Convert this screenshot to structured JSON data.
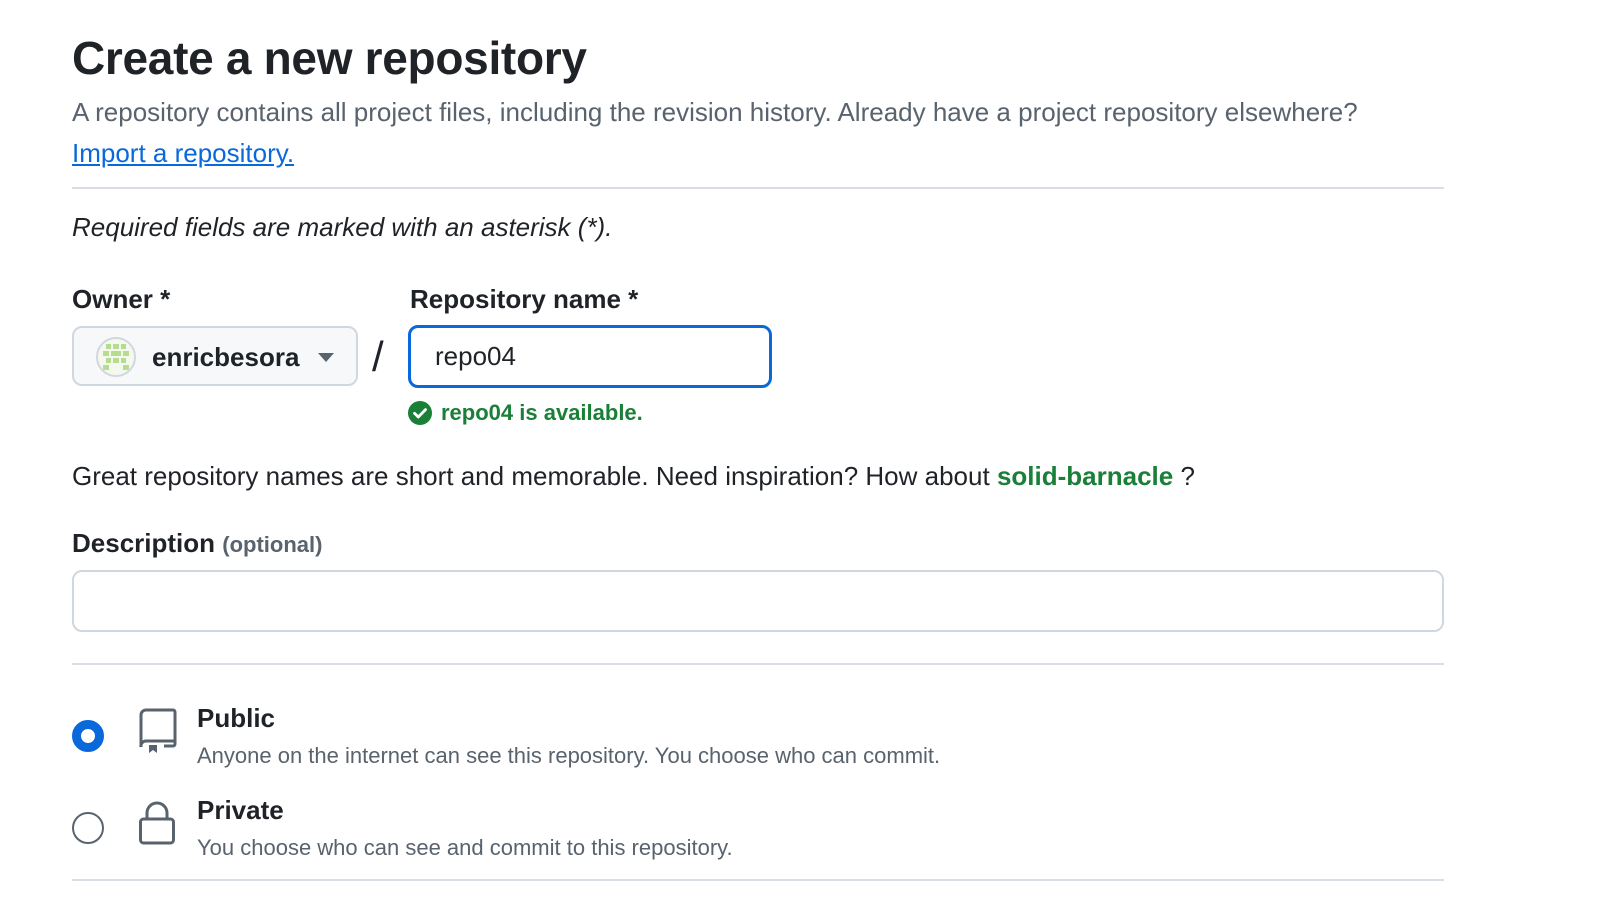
{
  "header": {
    "title": "Create a new repository",
    "subtitle": "A repository contains all project files, including the revision history. Already have a project repository elsewhere?",
    "import_link": "Import a repository."
  },
  "form": {
    "required_note": "Required fields are marked with an asterisk (*).",
    "owner": {
      "label": "Owner *",
      "value": "enricbesora"
    },
    "separator": "/",
    "repo_name": {
      "label": "Repository name *",
      "value": "repo04",
      "availability": "repo04 is available."
    },
    "hint": {
      "text": "Great repository names are short and memorable. Need inspiration? How about",
      "suggestion": "solid-barnacle",
      "suffix": "?"
    },
    "description": {
      "label": "Description",
      "optional": "(optional)",
      "value": ""
    },
    "visibility": {
      "selected": "Public",
      "options": [
        {
          "title": "Public",
          "description": "Anyone on the internet can see this repository. You choose who can commit.",
          "icon": "repo-icon"
        },
        {
          "title": "Private",
          "description": "You choose who can see and commit to this repository.",
          "icon": "lock-icon"
        }
      ]
    }
  },
  "colors": {
    "accent": "#0969da",
    "success": "#1a7f37",
    "muted_text": "#59636e",
    "border": "#d0d7de"
  }
}
